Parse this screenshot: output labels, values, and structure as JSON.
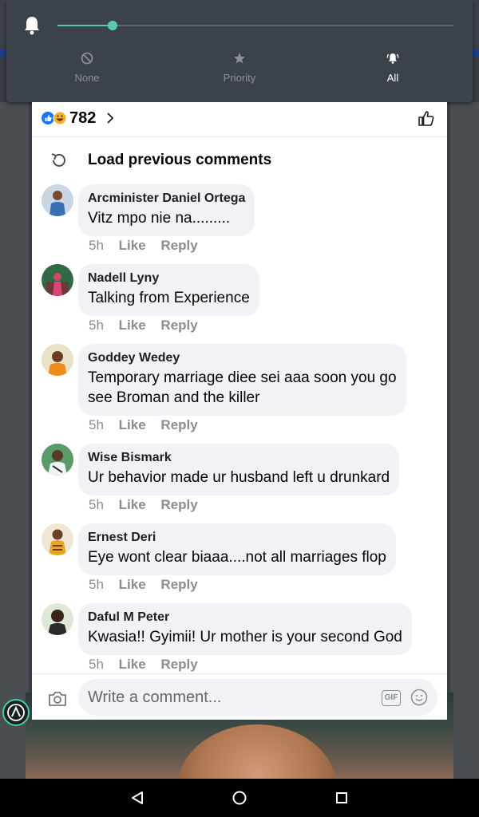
{
  "notification_modes": {
    "slider_level": 0.14,
    "none_label": "None",
    "priority_label": "Priority",
    "all_label": "All",
    "selected": "All",
    "accent_color": "#5cc9b5"
  },
  "reactions": {
    "count": "782"
  },
  "load_previous": "Load previous comments",
  "comments": [
    {
      "name": "Arcminister Daniel Ortega",
      "text": "Vitz mpo nie na.........",
      "time": "5h",
      "like": "Like",
      "reply": "Reply"
    },
    {
      "name": "Nadell Lyny",
      "text": "Talking from Experience",
      "time": "5h",
      "like": "Like",
      "reply": "Reply"
    },
    {
      "name": "Goddey Wedey",
      "text_line1": "Temporary marriage diee sei aaa soon you go",
      "text_line2": "see Broman and the killer",
      "time": "5h",
      "like": "Like",
      "reply": "Reply"
    },
    {
      "name": "Wise Bismark",
      "text": "Ur behavior made ur husband left u drunkard",
      "time": "5h",
      "like": "Like",
      "reply": "Reply"
    },
    {
      "name": "Ernest Deri",
      "text": "Eye wont clear biaaa....not all marriages flop",
      "time": "5h",
      "like": "Like",
      "reply": "Reply"
    },
    {
      "name": "Daful M Peter",
      "text": "Kwasia!! Gyimii! Ur mother is your second God",
      "time": "5h",
      "like": "Like",
      "reply": "Reply"
    }
  ],
  "composer": {
    "placeholder": "Write a comment...",
    "gif_label": "GIF"
  }
}
